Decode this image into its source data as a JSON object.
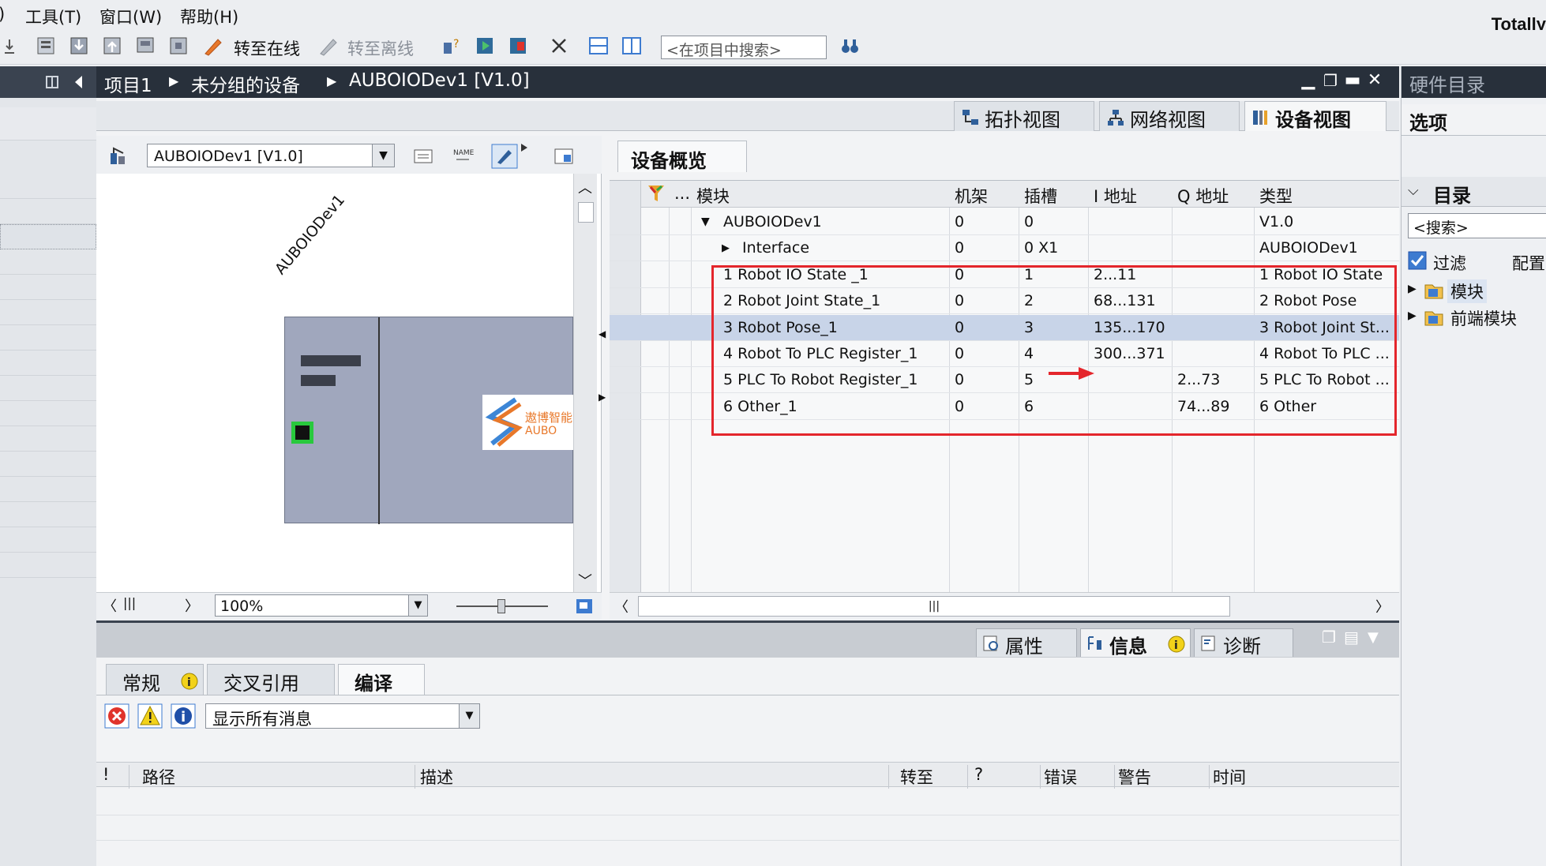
{
  "menu": {
    "items": [
      "工具(T)",
      "窗口(W)",
      "帮助(H)"
    ],
    "brand": "Totally"
  },
  "toolbar": {
    "go_online": "转至在线",
    "go_offline": "转至离线",
    "search_placeholder": "<在项目中搜索>"
  },
  "breadcrumb": {
    "parts": [
      "项目1",
      "未分组的设备",
      "AUBOIODev1 [V1.0]"
    ]
  },
  "view_tabs": [
    "拓扑视图",
    "网络视图",
    "设备视图"
  ],
  "device_view": {
    "selected_device": "AUBOIODev1 [V1.0]",
    "device_label": "AUBOIODev1",
    "logo_text_cn": "遨博智能",
    "logo_text_en": "AUBO",
    "zoom": "100%"
  },
  "overview": {
    "tab": "设备概览",
    "headers": {
      "dots": "...",
      "module": "模块",
      "rack": "机架",
      "slot": "插槽",
      "i_addr": "I 地址",
      "q_addr": "Q 地址",
      "type": "类型"
    },
    "rows": [
      {
        "module": "AUBOIODev1",
        "rack": "0",
        "slot": "0",
        "i_addr": "",
        "q_addr": "",
        "type": "V1.0"
      },
      {
        "module": "Interface",
        "rack": "0",
        "slot": "0 X1",
        "i_addr": "",
        "q_addr": "",
        "type": "AUBOIODev1"
      },
      {
        "module": "1 Robot IO State _1",
        "rack": "0",
        "slot": "1",
        "i_addr": "2...11",
        "q_addr": "",
        "type": "1 Robot IO State"
      },
      {
        "module": "2 Robot Joint State_1",
        "rack": "0",
        "slot": "2",
        "i_addr": "68...131",
        "q_addr": "",
        "type": "2 Robot Pose"
      },
      {
        "module": "3 Robot Pose_1",
        "rack": "0",
        "slot": "3",
        "i_addr": "135...170",
        "q_addr": "",
        "type": "3 Robot Joint St..."
      },
      {
        "module": "4 Robot To PLC Register_1",
        "rack": "0",
        "slot": "4",
        "i_addr": "300...371",
        "q_addr": "",
        "type": "4 Robot To PLC ..."
      },
      {
        "module": "5 PLC To Robot Register_1",
        "rack": "0",
        "slot": "5",
        "i_addr": "",
        "q_addr": "2...73",
        "type": "5 PLC To Robot ..."
      },
      {
        "module": "6 Other_1",
        "rack": "0",
        "slot": "6",
        "i_addr": "",
        "q_addr": "74...89",
        "type": "6 Other"
      }
    ]
  },
  "inspector": {
    "tabs": [
      "属性",
      "信息",
      "诊断"
    ],
    "subtabs": [
      "常规",
      "交叉引用",
      "编译"
    ],
    "filter": "显示所有消息",
    "columns": [
      "!",
      "路径",
      "描述",
      "转至",
      "?",
      "错误",
      "警告",
      "时间"
    ]
  },
  "catalog": {
    "title": "硬件目录",
    "options": "选项",
    "catalog_label": "目录",
    "search_placeholder": "<搜索>",
    "filter": "过滤",
    "config": "配置",
    "items": [
      "模块",
      "前端模块"
    ]
  },
  "colors": {
    "highlight_border": "#e4262c",
    "selected_row": "#c8d4e8",
    "titlebar": "#28303b"
  }
}
